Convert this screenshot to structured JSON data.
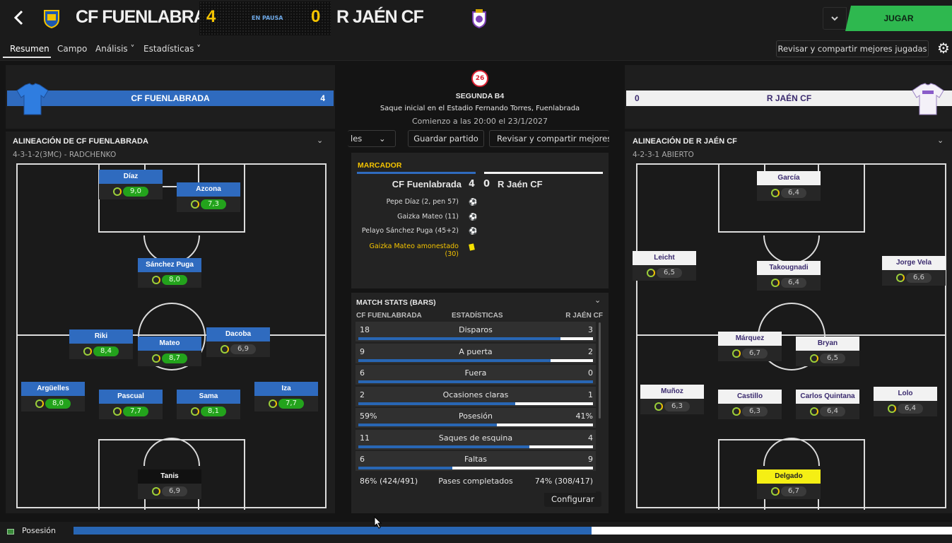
{
  "header": {
    "home_team": "CF FUENLABRADA",
    "away_team": "R JAÉN CF",
    "home_score": "4",
    "away_score": "0",
    "status": "EN PAUSA",
    "play_button": "JUGAR",
    "back_icon": "chevron-left-icon",
    "dropdown_icon": "chevron-down-icon"
  },
  "tabs": [
    {
      "label": "Resumen",
      "active": true
    },
    {
      "label": "Campo"
    },
    {
      "label": "Análisis ˅"
    },
    {
      "label": "Estadísticas ˅"
    }
  ],
  "toolbar": {
    "review_label": "Revisar y compartir mejores jugadas",
    "settings_icon": "gear-icon"
  },
  "home_panel": {
    "bar_name": "CF FUENLABRADA",
    "bar_score": "4",
    "lineup_title": "ALINEACIÓN DE CF FUENLABRADA",
    "formation": "4-3-1-2(3MC) - RADCHENKO",
    "players": [
      {
        "name": "Díaz",
        "rating": "9,0"
      },
      {
        "name": "Azcona",
        "rating": "7,3"
      },
      {
        "name": "Sánchez Puga",
        "rating": "8,0"
      },
      {
        "name": "Riki",
        "rating": "8,4"
      },
      {
        "name": "Mateo",
        "rating": "8,7"
      },
      {
        "name": "Dacoba",
        "rating": "6,9"
      },
      {
        "name": "Argüelles",
        "rating": "8,0"
      },
      {
        "name": "Pascual",
        "rating": "7,7"
      },
      {
        "name": "Sama",
        "rating": "8,1"
      },
      {
        "name": "Iza",
        "rating": "7,7"
      },
      {
        "name": "Tanis",
        "rating": "6,9"
      }
    ]
  },
  "away_panel": {
    "bar_name": "R JAÉN CF",
    "bar_score": "0",
    "lineup_title": "ALINEACIÓN DE R JAÉN CF",
    "formation": "4-2-3-1 ABIERTO",
    "players": [
      {
        "name": "García",
        "rating": "6,4"
      },
      {
        "name": "Leicht",
        "rating": "6,5"
      },
      {
        "name": "Takougnadi",
        "rating": "6,4"
      },
      {
        "name": "Jorge Vela",
        "rating": "6,6"
      },
      {
        "name": "Márquez",
        "rating": "6,7"
      },
      {
        "name": "Bryan",
        "rating": "6,5"
      },
      {
        "name": "Muñoz",
        "rating": "6,3"
      },
      {
        "name": "Castillo",
        "rating": "6,3"
      },
      {
        "name": "Carlos Quintana",
        "rating": "6,4"
      },
      {
        "name": "Lolo",
        "rating": "6,4"
      },
      {
        "name": "Delgado",
        "rating": "6,7"
      }
    ]
  },
  "center": {
    "competition_logo": "26",
    "competition": "SEGUNDA B4",
    "kickoff": "Saque inicial en el Estadio Fernando Torres, Fuenlabrada",
    "start": "Comienzo a las 20:00 el 23/1/2027",
    "chip_left": "les",
    "save_match": "Guardar partido",
    "review_short": "Revisar y compartir mejores ju",
    "scoreboard": {
      "title": "MARCADOR",
      "home": "CF Fuenlabrada",
      "home_score": "4",
      "away_score": "0",
      "away": "R Jaén CF",
      "events": [
        {
          "text": "Pepe Díaz (2, pen 57)",
          "type": "goal"
        },
        {
          "text": "Gaizka Mateo (11)",
          "type": "goal"
        },
        {
          "text": "Pelayo Sánchez Puga (45+2)",
          "type": "goal"
        },
        {
          "text": "Gaizka Mateo amonestado",
          "extra": "(30)",
          "type": "yellow-card"
        }
      ]
    },
    "stats": {
      "title": "MATCH STATS (BARS)",
      "col_home": "CF FUENLABRADA",
      "col_mid": "ESTADÍSTICAS",
      "col_away": "R JAÉN CF",
      "rows": [
        {
          "home": "18",
          "name": "Disparos",
          "away": "3",
          "share": 0.86
        },
        {
          "home": "9",
          "name": "A puerta",
          "away": "2",
          "share": 0.82
        },
        {
          "home": "6",
          "name": "Fuera",
          "away": "0",
          "share": 1.0
        },
        {
          "home": "2",
          "name": "Ocasiones claras",
          "away": "1",
          "share": 0.67
        },
        {
          "home": "59%",
          "name": "Posesión",
          "away": "41%",
          "share": 0.59
        },
        {
          "home": "11",
          "name": "Saques de esquina",
          "away": "4",
          "share": 0.73
        },
        {
          "home": "6",
          "name": "Faltas",
          "away": "9",
          "share": 0.4
        },
        {
          "home": "86% (424/491)",
          "name": "Pases completados",
          "away": "74% (308/417)",
          "share": null
        }
      ],
      "configure": "Configurar"
    }
  },
  "bottom": {
    "label": "Posesión",
    "home_share": 0.59
  }
}
